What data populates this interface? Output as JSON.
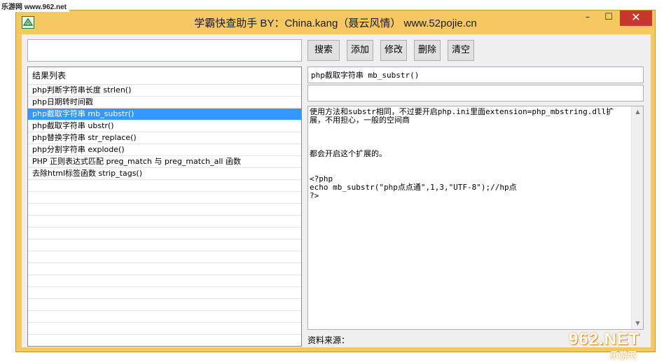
{
  "watermark_top": "乐游网 www.962.net",
  "window": {
    "title": "学霸快查助手  BY：China.kang（聂云风情）    www.52pojie.cn",
    "controls": {
      "minimize": "–",
      "maximize": "☐",
      "close": "✕"
    }
  },
  "search": {
    "value": "",
    "placeholder": ""
  },
  "toolbar": {
    "search": "搜索",
    "add": "添加",
    "edit": "修改",
    "delete": "删除",
    "clear": "清空"
  },
  "results": {
    "header": "结果列表",
    "selected_index": 2,
    "items": [
      "php判断字符串长度 strlen()",
      "php日期转时间戳",
      "php截取字符串 mb_substr()",
      "php截取字符串 ubstr()",
      "php替换字符串 str_replace()",
      "php分割字符串 explode()",
      "PHP 正则表达式匹配 preg_match 与 preg_match_all 函数",
      "去除html标签函数 strip_tags()"
    ],
    "empty_rows": 15
  },
  "detail": {
    "title_value": "php截取字符串 mb_substr()",
    "second_value": "",
    "content": "使用方法和substr相同，不过要开启php.ini里面extension=php_mbstring.dll扩展，不用担心，一般的空间商\n\n\n\n都会开启这个扩展的。\n\n\n<?php\necho mb_substr(\"php点点通\",1,3,\"UTF-8\");//hp点\n?>",
    "source_label": "资料来源："
  },
  "watermark_bottom": {
    "big": "962.NET",
    "small": "乐游网"
  },
  "colors": {
    "frame": "#f5c862",
    "selection": "#3399ff",
    "close_button": "#c7372c"
  }
}
